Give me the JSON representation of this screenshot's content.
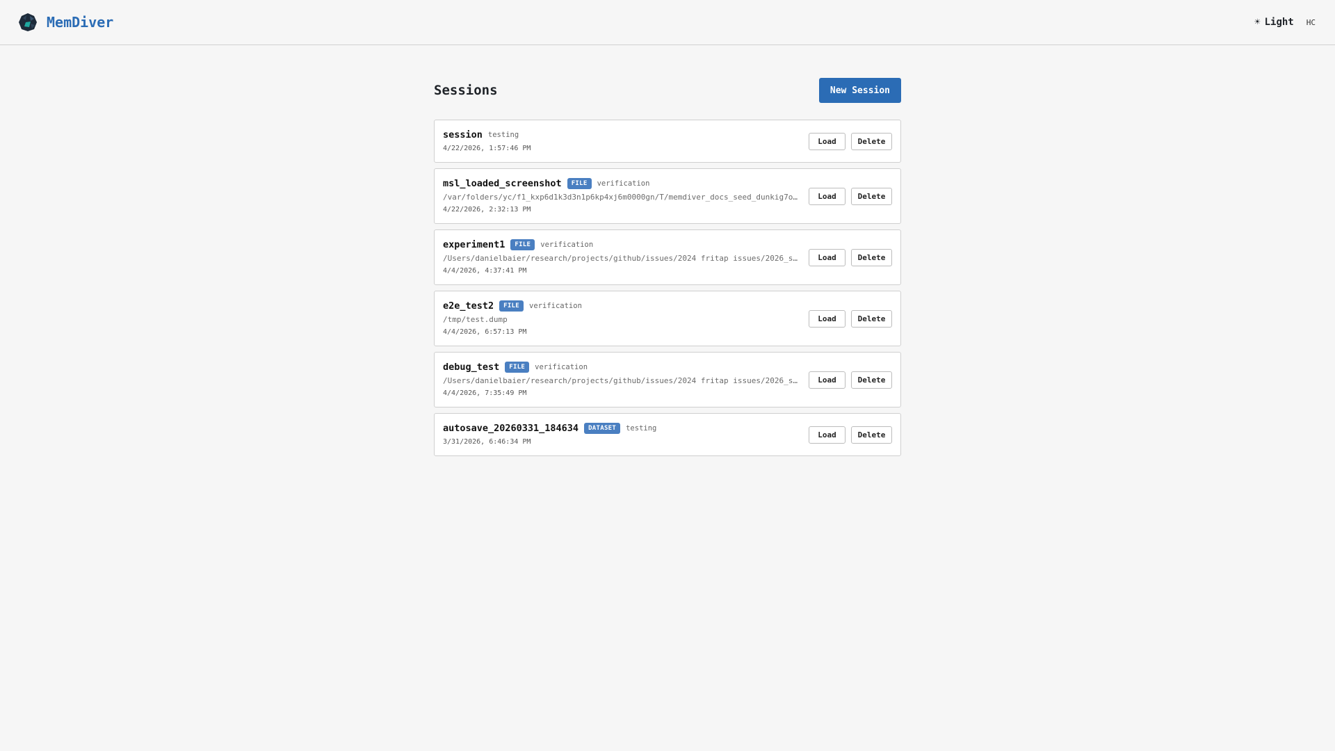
{
  "app": {
    "name": "MemDiver",
    "theme_label": "Light",
    "theme_icon": "☀",
    "hc_label": "HC"
  },
  "page": {
    "title": "Sessions",
    "new_session_label": "New Session"
  },
  "buttons": {
    "load": "Load",
    "delete": "Delete"
  },
  "sessions": [
    {
      "name": "session",
      "badge": "",
      "tag": "testing",
      "path": "",
      "date": "4/22/2026, 1:57:46 PM"
    },
    {
      "name": "msl_loaded_screenshot",
      "badge": "FILE",
      "tag": "verification",
      "path": "/var/folders/yc/f1_kxp6d1k3d3n1p6kp4xj6m0000gn/T/memdiver_docs_seed_dunkig7o…",
      "date": "4/22/2026, 2:32:13 PM"
    },
    {
      "name": "experiment1",
      "badge": "FILE",
      "tag": "verification",
      "path": "/Users/danielbaier/research/projects/github/issues/2024 fritap issues/2026_s…",
      "date": "4/4/2026, 4:37:41 PM"
    },
    {
      "name": "e2e_test2",
      "badge": "FILE",
      "tag": "verification",
      "path": "/tmp/test.dump",
      "date": "4/4/2026, 6:57:13 PM"
    },
    {
      "name": "debug_test",
      "badge": "FILE",
      "tag": "verification",
      "path": "/Users/danielbaier/research/projects/github/issues/2024 fritap issues/2026_s…",
      "date": "4/4/2026, 7:35:49 PM"
    },
    {
      "name": "autosave_20260331_184634",
      "badge": "DATASET",
      "tag": "testing",
      "path": "",
      "date": "3/31/2026, 6:46:34 PM"
    }
  ],
  "colors": {
    "brand": "#2b6cb5",
    "badge": "#4a7fc1"
  }
}
